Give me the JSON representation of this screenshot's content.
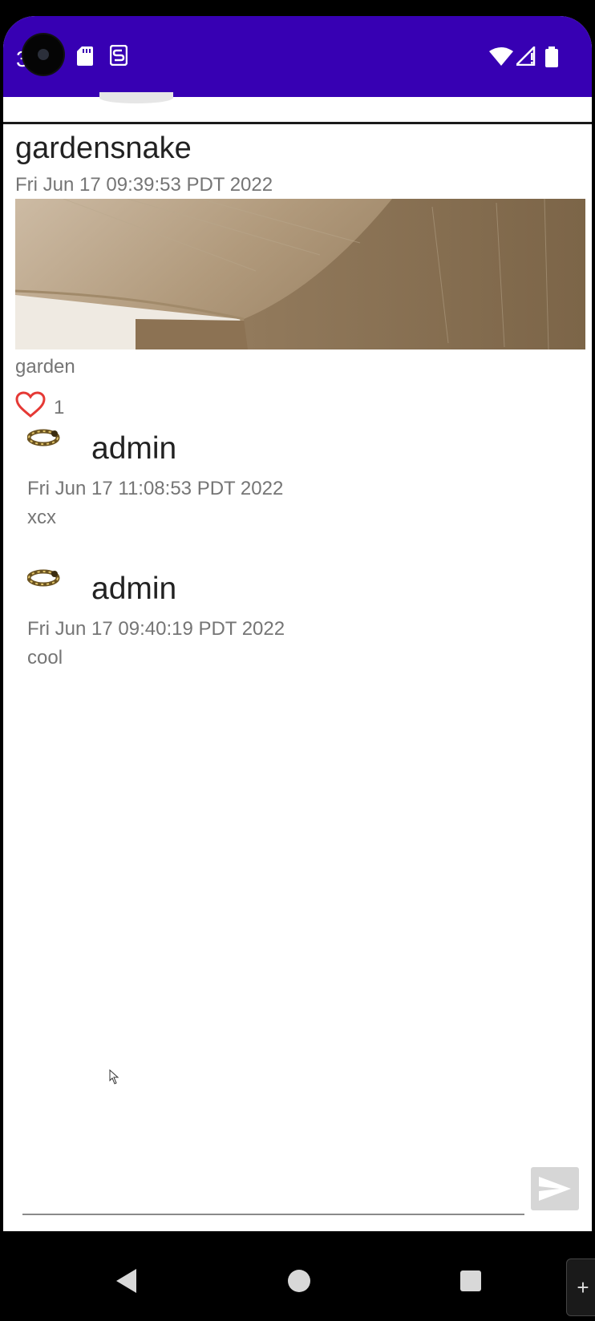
{
  "status_bar": {
    "time_fragment": "3",
    "icons": [
      "camera-cutout",
      "sd-card-icon",
      "s-notification-icon",
      "wifi-icon",
      "signal-icon",
      "battery-icon"
    ],
    "color": "#3700b3"
  },
  "post": {
    "author": "gardensnake",
    "date": "Fri Jun 17 09:39:53 PDT 2022",
    "caption": "garden",
    "likes": "1",
    "like_icon": "heart-outline-icon",
    "like_color": "#e53935"
  },
  "comments": [
    {
      "author": "admin",
      "date": "Fri Jun 17 11:08:53 PDT 2022",
      "text": "xcx"
    },
    {
      "author": "admin",
      "date": "Fri Jun 17 09:40:19 PDT 2022",
      "text": "cool"
    }
  ],
  "composer": {
    "placeholder": "",
    "send_icon": "send-icon"
  },
  "nav_bar": {
    "icons": [
      "back-icon",
      "home-icon",
      "recents-icon"
    ],
    "side_tab_label": "+"
  }
}
